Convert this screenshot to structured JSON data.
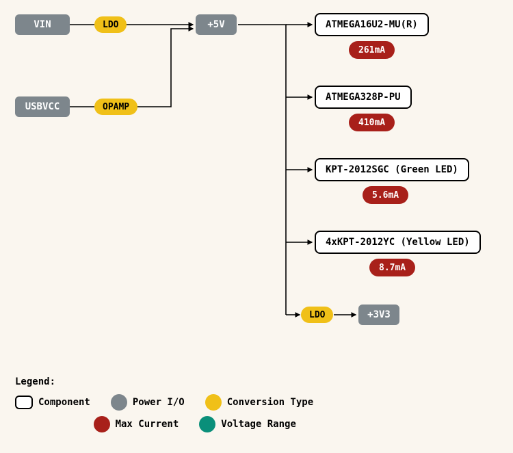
{
  "inputs": {
    "vin": "VIN",
    "usbvcc": "USBVCC"
  },
  "converters": {
    "ldo_top": "LDO",
    "opamp": "OPAMP",
    "ldo_3v3": "LDO"
  },
  "rails": {
    "five_v": "+5V",
    "three_v3": "+3V3"
  },
  "components": [
    {
      "name": "ATMEGA16U2-MU(R)",
      "current": "261mA"
    },
    {
      "name": "ATMEGA328P-PU",
      "current": "410mA"
    },
    {
      "name": "KPT-2012SGC (Green LED)",
      "current": "5.6mA"
    },
    {
      "name": "4xKPT-2012YC (Yellow LED)",
      "current": "8.7mA"
    }
  ],
  "legend": {
    "title": "Legend:",
    "component": "Component",
    "power_io": "Power I/O",
    "conversion": "Conversion Type",
    "max_current": "Max Current",
    "voltage_range": "Voltage Range"
  }
}
